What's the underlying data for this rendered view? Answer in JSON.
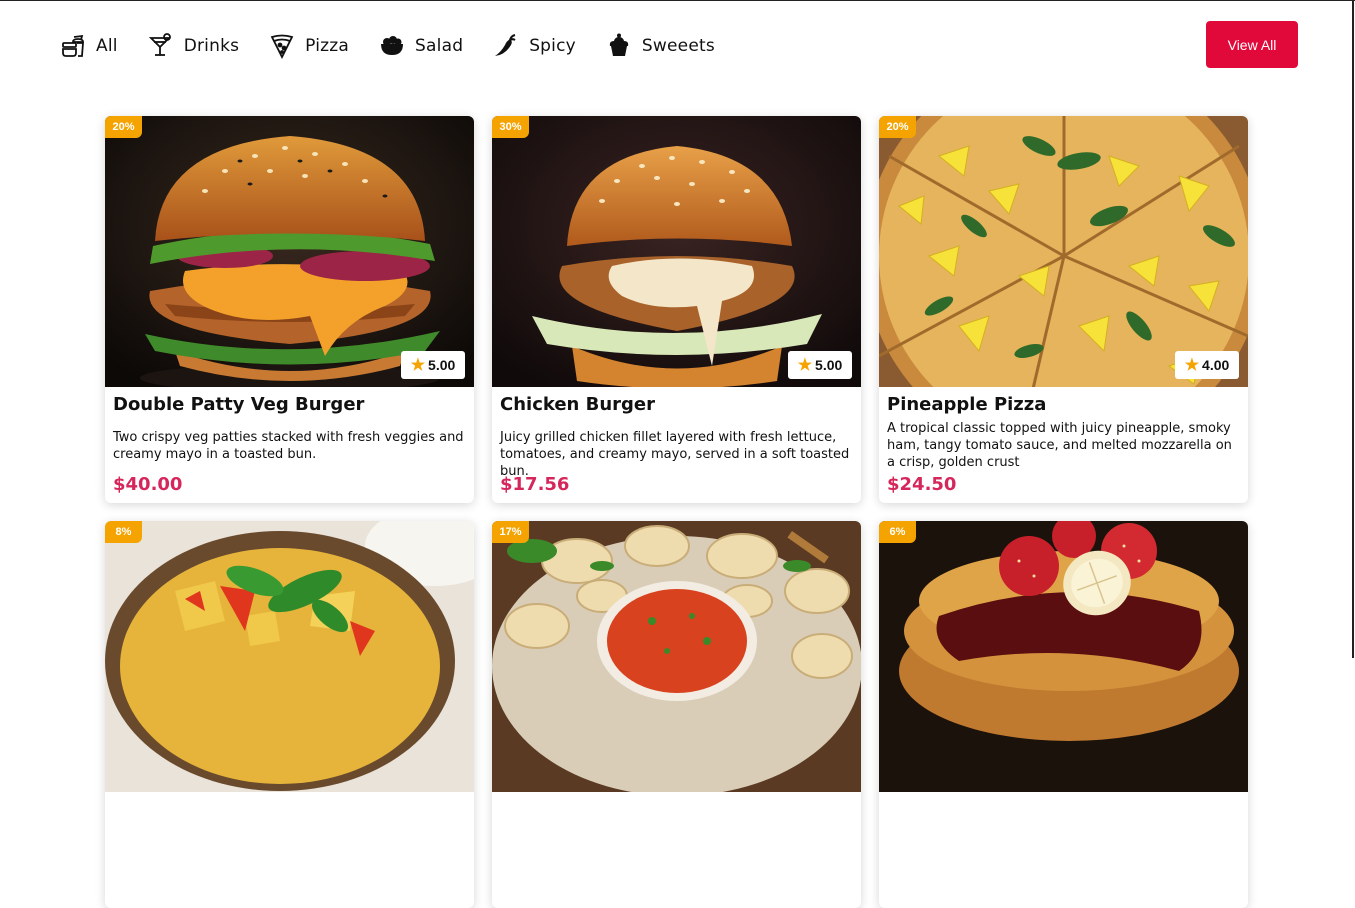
{
  "categories": [
    {
      "label": "All",
      "icon": "fast-food-icon"
    },
    {
      "label": "Drinks",
      "icon": "cocktail-icon"
    },
    {
      "label": "Pizza",
      "icon": "pizza-slice-icon"
    },
    {
      "label": "Salad",
      "icon": "salad-bowl-icon"
    },
    {
      "label": "Spicy",
      "icon": "chili-pepper-icon"
    },
    {
      "label": "Sweeets",
      "icon": "cupcake-icon"
    }
  ],
  "view_all_label": "View All",
  "products": [
    {
      "name": "Double Patty Veg Burger",
      "description": "Two crispy veg patties stacked with fresh veggies and creamy mayo in a toasted bun.",
      "price": "$40.00",
      "discount": "20%",
      "rating": "5.00"
    },
    {
      "name": "Chicken Burger",
      "description": "Juicy grilled chicken fillet layered with fresh lettuce, tomatoes, and creamy mayo, served in a soft toasted bun.",
      "price": "$17.56",
      "discount": "30%",
      "rating": "5.00"
    },
    {
      "name": "Pineapple Pizza",
      "description": "A tropical classic topped with juicy pineapple, smoky ham, tangy tomato sauce, and melted mozzarella on a crisp, golden crust",
      "price": "$24.50",
      "discount": "20%",
      "rating": "4.00"
    },
    {
      "discount": "8%"
    },
    {
      "discount": "17%"
    },
    {
      "discount": "6%"
    }
  ],
  "colors": {
    "accent": "#e0093a",
    "price": "#d6275c",
    "badge": "#f5a300"
  }
}
